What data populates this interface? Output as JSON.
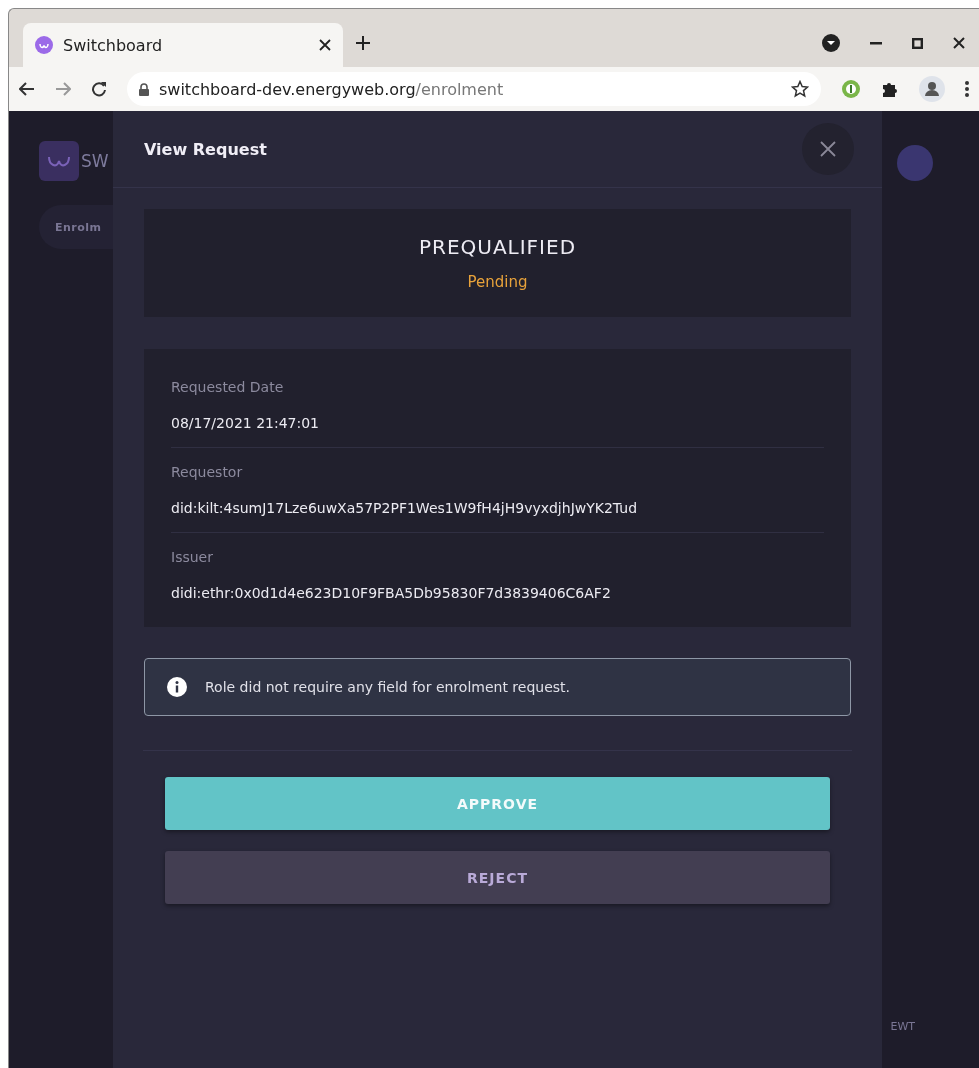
{
  "browser": {
    "tab_title": "Switchboard",
    "url_host": "switchboard-dev.energyweb.org",
    "url_path": "/enrolment"
  },
  "background": {
    "logo_text": "SW",
    "tab_label": "Enrolm",
    "nav_right": "EWT"
  },
  "modal": {
    "title": "View Request",
    "role": "PREQUALIFIED",
    "status": "Pending",
    "fields": [
      {
        "label": "Requested Date",
        "value": "08/17/2021 21:47:01"
      },
      {
        "label": "Requestor",
        "value": "did:kilt:4sumJ17Lze6uwXa57P2PF1Wes1W9fH4jH9vyxdjhJwYK2Tud"
      },
      {
        "label": "Issuer",
        "value": "didi:ethr:0x0d1d4e623D10F9FBA5Db95830F7d3839406C6AF2"
      }
    ],
    "info": "Role did not require any field for enrolment request.",
    "buttons": [
      {
        "label": "APPROVE",
        "kind": "primary"
      },
      {
        "label": "REJECT",
        "kind": "secondary"
      }
    ]
  }
}
